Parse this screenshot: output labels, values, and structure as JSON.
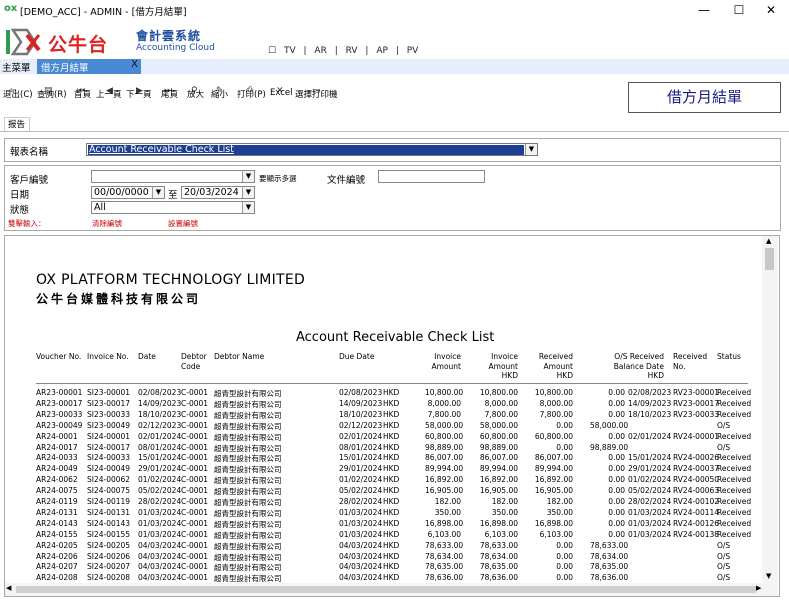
{
  "window": {
    "title": "[DEMO_ACC] - ADMIN - [借方月結單]",
    "min": "—",
    "max": "☐",
    "close": "✕"
  },
  "brand": {
    "logo_cn": "公牛台",
    "ac_cn": "會計雲系統",
    "ac_en": "Accounting Cloud",
    "menu": [
      "☐",
      "TV",
      "|",
      "AR",
      "|",
      "RV",
      "|",
      "AP",
      "|",
      "PV"
    ]
  },
  "tabs": {
    "main": "主菜單",
    "active": "借方月結單",
    "close": "X"
  },
  "toolbar": {
    "items": [
      "退出(C)",
      "查詢(R)",
      "首頁",
      "上一頁",
      "下一頁",
      "尾頁",
      "放大",
      "縮小",
      "打印(P)",
      "Excel",
      "選擇打印機"
    ],
    "header_box": "借方月結單"
  },
  "subtab": "报告",
  "report_select": {
    "label": "報表名稱",
    "value": "Account Receivable Check List"
  },
  "filter": {
    "customer_label": "客戶編號",
    "multi_label": "要顯示多選",
    "doc_label": "文件編號",
    "date_label": "日期",
    "date_from": "00/00/0000",
    "to_label": "至",
    "date_to": "20/03/2024",
    "status_label": "狀態",
    "status_value": "All",
    "hint1": "雙擊輸入：",
    "hint2": "清除編號",
    "hint3": "設置編號"
  },
  "report": {
    "company_en": "OX PLATFORM TECHNOLOGY LIMITED",
    "company_cn": "公牛台媒體科技有限公司",
    "title": "Account Receivable Check List",
    "headers": [
      "Voucher No.",
      "Invoice No.",
      "Date",
      "Debtor Code",
      "Debtor Name",
      "Due Date",
      "Invoice Amount",
      "Invoice Amount HKD",
      "Received Amount HKD",
      "O/S Received Balance Date HKD",
      "Received No.",
      "Status"
    ],
    "rows": [
      [
        "AR23-00001",
        "SI23-00001",
        "02/08/2023",
        "C-0001",
        "超青型設計有限公司",
        "02/08/2023",
        "HKD",
        "10,800.00",
        "10,800.00",
        "10,800.00",
        "0.00",
        "02/08/2023",
        "RV23-00001",
        "Received"
      ],
      [
        "AR23-00017",
        "SI23-00017",
        "14/09/2023",
        "C-0001",
        "超青型設計有限公司",
        "14/09/2023",
        "HKD",
        "8,000.00",
        "8,000.00",
        "8,000.00",
        "0.00",
        "14/09/2023",
        "RV23-00017",
        "Received"
      ],
      [
        "AR23-00033",
        "SI23-00033",
        "18/10/2023",
        "C-0001",
        "超青型設計有限公司",
        "18/10/2023",
        "HKD",
        "7,800.00",
        "7,800.00",
        "7,800.00",
        "0.00",
        "18/10/2023",
        "RV23-00033",
        "Received"
      ],
      [
        "AR23-00049",
        "SI23-00049",
        "02/12/2023",
        "C-0001",
        "超青型設計有限公司",
        "02/12/2023",
        "HKD",
        "58,000.00",
        "58,000.00",
        "0.00",
        "58,000.00",
        "",
        "",
        "O/S"
      ],
      [
        "AR24-0001",
        "SI24-00001",
        "02/01/2024",
        "C-0001",
        "超青型設計有限公司",
        "02/01/2024",
        "HKD",
        "60,800.00",
        "60,800.00",
        "60,800.00",
        "0.00",
        "02/01/2024",
        "RV24-00001",
        "Received"
      ],
      [
        "AR24-0017",
        "SI24-00017",
        "08/01/2024",
        "C-0001",
        "超青型設計有限公司",
        "08/01/2024",
        "HKD",
        "98,889.00",
        "98,889.00",
        "0.00",
        "98,889.00",
        "",
        "",
        "O/S"
      ],
      [
        "AR24-0033",
        "SI24-00033",
        "15/01/2024",
        "C-0001",
        "超青型設計有限公司",
        "15/01/2024",
        "HKD",
        "86,007.00",
        "86,007.00",
        "86,007.00",
        "0.00",
        "15/01/2024",
        "RV24-00026",
        "Received"
      ],
      [
        "AR24-0049",
        "SI24-00049",
        "29/01/2024",
        "C-0001",
        "超青型設計有限公司",
        "29/01/2024",
        "HKD",
        "89,994.00",
        "89,994.00",
        "89,994.00",
        "0.00",
        "29/01/2024",
        "RV24-00037",
        "Received"
      ],
      [
        "AR24-0062",
        "SI24-00062",
        "01/02/2024",
        "C-0001",
        "超青型設計有限公司",
        "01/02/2024",
        "HKD",
        "16,892.00",
        "16,892.00",
        "16,892.00",
        "0.00",
        "01/02/2024",
        "RV24-00050",
        "Received"
      ],
      [
        "AR24-0075",
        "SI24-00075",
        "05/02/2024",
        "C-0001",
        "超青型設計有限公司",
        "05/02/2024",
        "HKD",
        "16,905.00",
        "16,905.00",
        "16,905.00",
        "0.00",
        "05/02/2024",
        "RV24-00063",
        "Received"
      ],
      [
        "AR24-0119",
        "SI24-00119",
        "28/02/2024",
        "C-0001",
        "超青型設計有限公司",
        "28/02/2024",
        "HKD",
        "182.00",
        "182.00",
        "182.00",
        "0.00",
        "28/02/2024",
        "RV24-00102",
        "Received"
      ],
      [
        "AR24-0131",
        "SI24-00131",
        "01/03/2024",
        "C-0001",
        "超青型設計有限公司",
        "01/03/2024",
        "HKD",
        "350.00",
        "350.00",
        "350.00",
        "0.00",
        "01/03/2024",
        "RV24-00114",
        "Received"
      ],
      [
        "AR24-0143",
        "SI24-00143",
        "01/03/2024",
        "C-0001",
        "超青型設計有限公司",
        "01/03/2024",
        "HKD",
        "16,898.00",
        "16,898.00",
        "16,898.00",
        "0.00",
        "01/03/2024",
        "RV24-00126",
        "Received"
      ],
      [
        "AR24-0155",
        "SI24-00155",
        "01/03/2024",
        "C-0001",
        "超青型設計有限公司",
        "01/03/2024",
        "HKD",
        "6,103.00",
        "6,103.00",
        "6,103.00",
        "0.00",
        "01/03/2024",
        "RV24-00138",
        "Received"
      ],
      [
        "AR24-0205",
        "SI24-00205",
        "04/03/2024",
        "C-0001",
        "超青型設計有限公司",
        "04/03/2024",
        "HKD",
        "78,633.00",
        "78,633.00",
        "0.00",
        "78,633.00",
        "",
        "",
        "O/S"
      ],
      [
        "AR24-0206",
        "SI24-00206",
        "04/03/2024",
        "C-0001",
        "超青型設計有限公司",
        "04/03/2024",
        "HKD",
        "78,634.00",
        "78,634.00",
        "0.00",
        "78,634.00",
        "",
        "",
        "O/S"
      ],
      [
        "AR24-0207",
        "SI24-00207",
        "04/03/2024",
        "C-0001",
        "超青型設計有限公司",
        "04/03/2024",
        "HKD",
        "78,635.00",
        "78,635.00",
        "0.00",
        "78,635.00",
        "",
        "",
        "O/S"
      ],
      [
        "AR24-0208",
        "SI24-00208",
        "04/03/2024",
        "C-0001",
        "超青型設計有限公司",
        "04/03/2024",
        "HKD",
        "78,636.00",
        "78,636.00",
        "0.00",
        "78,636.00",
        "",
        "",
        "O/S"
      ]
    ]
  },
  "colors": {
    "accent": "#1c3f94",
    "tab_active": "#4a8ad4",
    "logo_red": "#d22222",
    "logo_green": "#2e9b4e"
  }
}
